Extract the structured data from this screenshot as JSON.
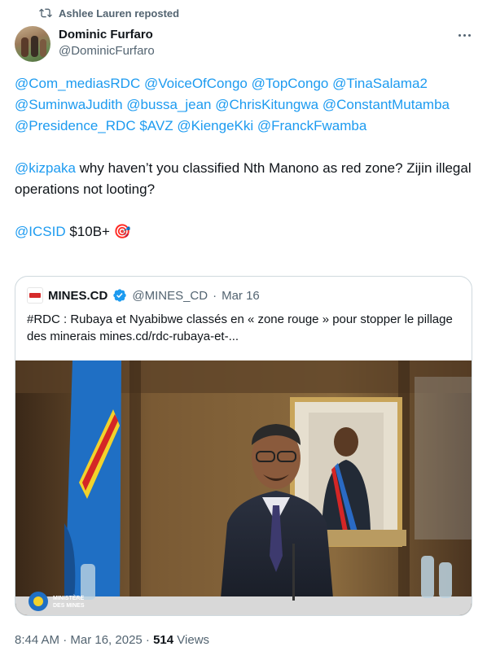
{
  "repost": {
    "label": "Ashlee Lauren reposted",
    "icon": "repost-icon"
  },
  "author": {
    "name": "Dominic Furfaro",
    "handle": "@DominicFurfaro"
  },
  "tweet": {
    "mentions": [
      "@Com_mediasRDC",
      "@VoiceOfCongo",
      "@TopCongo",
      "@TinaSalama2",
      "@SuminwaJudith",
      "@bussa_jean",
      "@ChrisKitungwa",
      "@ConstantMutamba",
      "@Presidence_RDC",
      "$AVZ",
      "@KiengeKki",
      "@FranckFwamba"
    ],
    "question_mention": "@kizpaka",
    "question_text": " why haven’t you classified Nth Manono as red zone? Zijin illegal operations not looting?",
    "icsid_mention": "@ICSID",
    "icsid_text": " $10B+ ",
    "emoji": "🎯"
  },
  "quote": {
    "name": "MINES.CD",
    "handle": "@MINES_CD",
    "separator": "·",
    "date": "Mar 16",
    "text": "#RDC : Rubaya et Nyabibwe classés en « zone rouge » pour stopper le pillage des minerais  mines.cd/rdc-rubaya-et-...",
    "image_logo_text": "MINISTÈRE DES MINES"
  },
  "meta": {
    "time_date": "8:44 AM · Mar 16, 2025 · ",
    "views_count": "514",
    "views_label": " Views"
  },
  "colors": {
    "link": "#1d9bf0",
    "text": "#0f1419",
    "muted": "#536471",
    "border": "#cfd9de"
  }
}
